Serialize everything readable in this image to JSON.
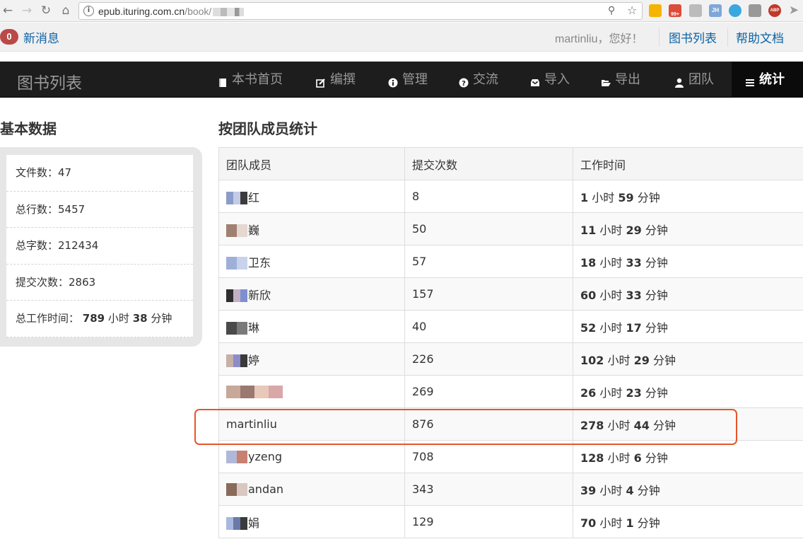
{
  "browser": {
    "url_host": "epub.ituring.com.cn",
    "url_path": "/book/",
    "back_icon": "arrow-left-icon",
    "forward_icon": "arrow-right-icon",
    "reload_icon": "reload-icon",
    "home_icon": "home-icon",
    "ext_badge": "99+",
    "ext_jh": "JH",
    "ext_abp": "ABP"
  },
  "notify": {
    "count": "0",
    "messages_label": "新消息",
    "greeting": "martinliu，您好！",
    "book_list_link": "图书列表",
    "help_link": "帮助文档"
  },
  "nav": {
    "brand": "图书列表",
    "items": [
      {
        "label": "本书首页",
        "icon": "book-icon"
      },
      {
        "label": "编撰",
        "icon": "edit-icon"
      },
      {
        "label": "管理",
        "icon": "info-icon"
      },
      {
        "label": "交流",
        "icon": "question-icon"
      },
      {
        "label": "导入",
        "icon": "inbox-icon"
      },
      {
        "label": "导出",
        "icon": "folder-open-icon"
      },
      {
        "label": "团队",
        "icon": "user-icon"
      },
      {
        "label": "统计",
        "icon": "list-icon"
      }
    ]
  },
  "basic": {
    "title": "基本数据",
    "files_label": "文件数：",
    "files_value": "47",
    "lines_label": "总行数：",
    "lines_value": "5457",
    "chars_label": "总字数：",
    "chars_value": "212434",
    "commits_label": "提交次数：",
    "commits_value": "2863",
    "worktime_label": "总工作时间：",
    "worktime_hours": "789",
    "hour_unit": "小时",
    "worktime_minutes": "38",
    "minute_unit": "分钟"
  },
  "team": {
    "title": "按团队成员统计",
    "headers": [
      "团队成员",
      "提交次数",
      "工作时间"
    ],
    "hour_unit": "小时",
    "minute_unit": "分钟",
    "rows": [
      {
        "member": "红",
        "commits": "8",
        "hours": "1",
        "minutes": "59"
      },
      {
        "member": "巍",
        "commits": "50",
        "hours": "11",
        "minutes": "29"
      },
      {
        "member": "卫东",
        "commits": "57",
        "hours": "18",
        "minutes": "33"
      },
      {
        "member": "新欣",
        "commits": "157",
        "hours": "60",
        "minutes": "33"
      },
      {
        "member": "琳",
        "commits": "40",
        "hours": "52",
        "minutes": "17"
      },
      {
        "member": "婷",
        "commits": "226",
        "hours": "102",
        "minutes": "29"
      },
      {
        "member": "",
        "commits": "269",
        "hours": "26",
        "minutes": "23"
      },
      {
        "member": "martinliu",
        "commits": "876",
        "hours": "278",
        "minutes": "44"
      },
      {
        "member": "yzeng",
        "commits": "708",
        "hours": "128",
        "minutes": "6"
      },
      {
        "member": "andan",
        "commits": "343",
        "hours": "39",
        "minutes": "4"
      },
      {
        "member": "娟",
        "commits": "129",
        "hours": "70",
        "minutes": "1"
      }
    ]
  },
  "colors": {
    "nav_bg": "#1d1d1d",
    "link": "#0b63a5",
    "badge": "#b94a48",
    "highlight": "#e8542b"
  }
}
